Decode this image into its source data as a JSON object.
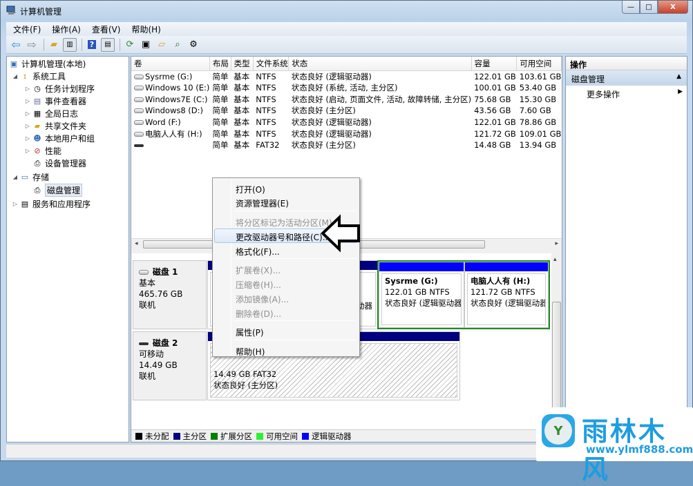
{
  "window": {
    "title": "计算机管理",
    "minimize": "—",
    "restore": "□",
    "close": "X"
  },
  "menubar": [
    "文件(F)",
    "操作(A)",
    "查看(V)",
    "帮助(H)"
  ],
  "toolbar": {
    "icons": [
      "back-arrow-icon",
      "forward-arrow-icon",
      "up-folder-icon",
      "show-hide-tree-icon",
      "help-icon",
      "show-hide-action-pane-icon",
      "refresh-icon",
      "properties-icon",
      "open-folder-icon",
      "rescan-disks-icon",
      "settings-icon"
    ]
  },
  "tree": {
    "root": "计算机管理(本地)",
    "system_tools": "系统工具",
    "task_scheduler": "任务计划程序",
    "event_viewer": "事件查看器",
    "global_log": "全局日志",
    "shared_folders": "共享文件夹",
    "local_users": "本地用户和组",
    "performance": "性能",
    "device_manager": "设备管理器",
    "storage": "存储",
    "disk_management": "磁盘管理",
    "services": "服务和应用程序"
  },
  "volumes": {
    "headers": [
      "卷",
      "布局",
      "类型",
      "文件系统",
      "状态",
      "容量",
      "可用空间"
    ],
    "rows": [
      {
        "name": "Sysrme (G:)",
        "layout": "简单",
        "type": "基本",
        "fs": "NTFS",
        "status": "状态良好 (逻辑驱动器)",
        "capacity": "122.01 GB",
        "free": "103.61 GB",
        "removable": false
      },
      {
        "name": "Windows 10 (E:)",
        "layout": "简单",
        "type": "基本",
        "fs": "NTFS",
        "status": "状态良好 (系统, 活动, 主分区)",
        "capacity": "100.01 GB",
        "free": "53.40 GB",
        "removable": false
      },
      {
        "name": "Windows7E (C:)",
        "layout": "简单",
        "type": "基本",
        "fs": "NTFS",
        "status": "状态良好 (启动, 页面文件, 活动, 故障转储, 主分区)",
        "capacity": "75.68 GB",
        "free": "15.30 GB",
        "removable": false
      },
      {
        "name": "Windows8 (D:)",
        "layout": "简单",
        "type": "基本",
        "fs": "NTFS",
        "status": "状态良好 (主分区)",
        "capacity": "43.56 GB",
        "free": "7.60 GB",
        "removable": false
      },
      {
        "name": "Word (F:)",
        "layout": "简单",
        "type": "基本",
        "fs": "NTFS",
        "status": "状态良好 (逻辑驱动器)",
        "capacity": "122.01 GB",
        "free": "78.86 GB",
        "removable": false
      },
      {
        "name": "电脑人人有 (H:)",
        "layout": "简单",
        "type": "基本",
        "fs": "NTFS",
        "status": "状态良好 (逻辑驱动器)",
        "capacity": "121.72 GB",
        "free": "109.01 GB",
        "removable": false
      },
      {
        "name": "",
        "layout": "简单",
        "type": "基本",
        "fs": "FAT32",
        "status": "状态良好 (主分区)",
        "capacity": "14.48 GB",
        "free": "13.94 GB",
        "removable": true
      }
    ]
  },
  "disks": [
    {
      "name": "磁盘 1",
      "kind": "基本",
      "size": "465.76 GB",
      "state": "联机",
      "partitions": [
        {
          "title": "Sysrme  (G:)",
          "size": "122.01 GB NTFS",
          "status": "状态良好 (逻辑驱动器)"
        },
        {
          "title": "电脑人人有  (H:)",
          "size": "121.72 GB NTFS",
          "status": "状态良好 (逻辑驱动器"
        }
      ],
      "hidden_partial_text": "动器"
    },
    {
      "name": "磁盘 2",
      "kind": "可移动",
      "size": "14.49 GB",
      "state": "联机",
      "partitions": [
        {
          "title": "",
          "size": "14.49 GB FAT32",
          "status": "状态良好 (主分区)"
        }
      ]
    }
  ],
  "legend": [
    {
      "label": "未分配",
      "color": "#000000"
    },
    {
      "label": "主分区",
      "color": "#000080"
    },
    {
      "label": "扩展分区",
      "color": "#008000"
    },
    {
      "label": "可用空间",
      "color": "#33ee33"
    },
    {
      "label": "逻辑驱动器",
      "color": "#0000ff"
    }
  ],
  "actions": {
    "header": "操作",
    "section": "磁盘管理",
    "more": "更多操作"
  },
  "context_menu": [
    {
      "label": "打开(O)",
      "enabled": true
    },
    {
      "label": "资源管理器(E)",
      "enabled": true
    },
    {
      "label": "将分区标记为活动分区(M)",
      "enabled": false
    },
    {
      "label": "更改驱动器号和路径(C)...",
      "enabled": true,
      "highlighted": true
    },
    {
      "label": "格式化(F)...",
      "enabled": true
    },
    {
      "label": "扩展卷(X)...",
      "enabled": false
    },
    {
      "label": "压缩卷(H)...",
      "enabled": false
    },
    {
      "label": "添加镜像(A)...",
      "enabled": false
    },
    {
      "label": "删除卷(D)...",
      "enabled": false
    },
    {
      "label": "属性(P)",
      "enabled": true
    },
    {
      "label": "帮助(H)",
      "enabled": true
    }
  ],
  "colors": {
    "primary_partition": "#000080",
    "logical_drive": "#0000ff",
    "extended_partition": "#008000",
    "selection": "#c3d5ea"
  },
  "watermark": {
    "brand": "雨林木风",
    "url": "www.ylmf888.com"
  }
}
